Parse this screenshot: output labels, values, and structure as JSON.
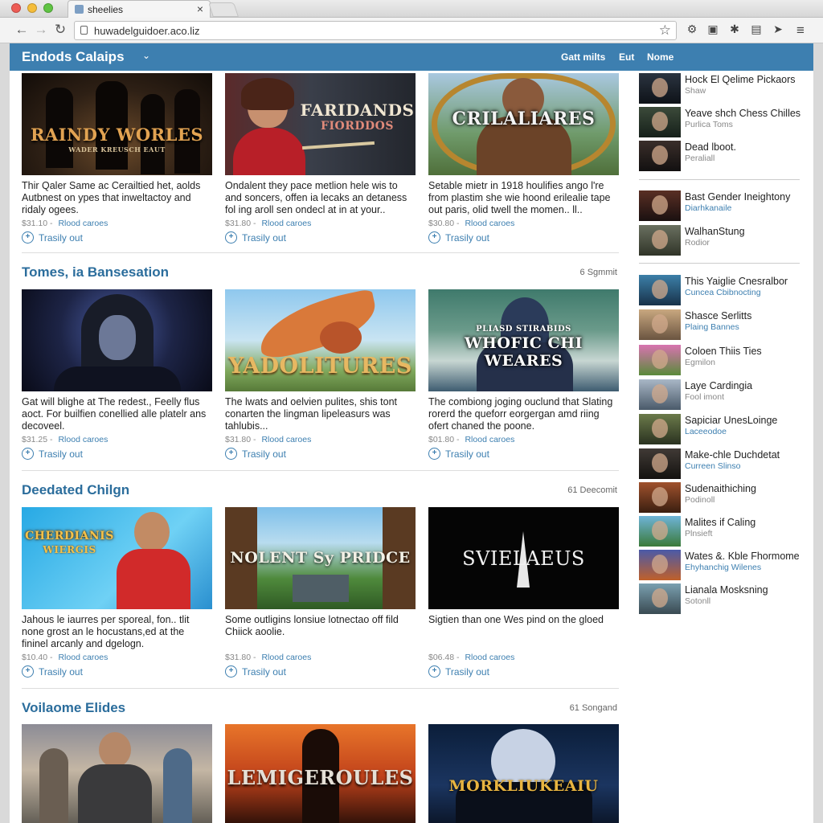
{
  "browser": {
    "tab_title": "sheelies",
    "url": "huwadelguidoer.aco.liz"
  },
  "site": {
    "brand": "Endods Calaips",
    "nav": [
      "Gatt milts",
      "Eut",
      "Nome"
    ]
  },
  "sections": [
    {
      "title": "",
      "count": "",
      "cards": [
        {
          "thumb_title": "RAINDY WORLES",
          "thumb_sub": "WADER KREUSCH EAUT",
          "desc": "Thir Qaler Same ac Cerailtied het, aolds Autbnest on ypes that inweltactoy and ridaly ogees.",
          "price": "$31.10",
          "link": "Rlood caroes",
          "follow": "Trasily out"
        },
        {
          "thumb_title": "FARIDANDS",
          "thumb_sub": "FIORDDOS",
          "desc": "Ondalent they pace metlion hele wis to and soncers, offen ia lecaks an detaness fol ing aroll sen ondecl at in at your..",
          "price": "$31.80",
          "link": "Rlood caroes",
          "follow": "Trasily out"
        },
        {
          "thumb_title": "CRILALIARES",
          "thumb_sub": "",
          "desc": "Setable mietr in 1918 houlifies ango l're from plastim she wie hoond erilealie tape out paris, olid twell the momen.. ll..",
          "price": "$30.80",
          "link": "Rlood caroes",
          "follow": "Trasily out"
        }
      ]
    },
    {
      "title": "Tomes, ia Bansesation",
      "count": "6 Sgmmit",
      "cards": [
        {
          "thumb_title": "",
          "thumb_sub": "",
          "desc": "Gat will blighe at The redest., Feelly flus aoct. For builfien conellied alle platelr ans decoveel.",
          "price": "$31.25",
          "link": "Rlood caroes",
          "follow": "Trasily out"
        },
        {
          "thumb_title": "YADOLITURES",
          "thumb_sub": "",
          "desc": "The lwats and oelvien pulites, shis tont conarten the lingman lipeleasurs was tahlubis...",
          "price": "$31.80",
          "link": "Rlood caroes",
          "follow": "Trasily out"
        },
        {
          "thumb_title": "WHOFIC CHI WEARES",
          "thumb_sub": "PLIASD STIRABIDS",
          "desc": "The combiong joging ouclund that Slating rorerd the queforr eorgergan amd riing ofert chaned the poone.",
          "price": "$01.80",
          "link": "Rlood caroes",
          "follow": "Trasily out"
        }
      ]
    },
    {
      "title": "Deedated Chilgn",
      "count": "61 Deecomit",
      "cards": [
        {
          "thumb_title": "CHERDIANIS",
          "thumb_sub": "WIERGIS",
          "desc": "Jahous le iaurres per sporeal, fon.. tlit none grost an le hocustans,ed at the fininel arcanly and dgelogn.",
          "price": "$10.40",
          "link": "Rlood caroes",
          "follow": "Trasily out"
        },
        {
          "thumb_title": "NOLENT Sy PRIDCE",
          "thumb_sub": "",
          "desc": "Some outligins lonsiue lotnectao off fild Chiick aoolie.",
          "price": "$31.80",
          "link": "Rlood caroes",
          "follow": "Trasily out"
        },
        {
          "thumb_title": "SVIELAEUS",
          "thumb_sub": "",
          "desc": "Sigtien than one Wes pind on the gloed",
          "price": "$06.48",
          "link": "Rlood caroes",
          "follow": "Trasily out"
        }
      ]
    },
    {
      "title": "Voilaome Elides",
      "count": "61 Songand",
      "cards": [
        {
          "thumb_title": "",
          "thumb_sub": ""
        },
        {
          "thumb_title": "LEMIGEROULES",
          "thumb_sub": ""
        },
        {
          "thumb_title": "MORKLIUKEAIU",
          "thumb_sub": ""
        }
      ]
    }
  ],
  "sidebar": [
    {
      "title": "Hock El Qelime Pickaors",
      "sub": "Shaw",
      "sub_color": "#888888"
    },
    {
      "title": "Yeave shch Chess Chilles",
      "sub": "Purlica Toms",
      "sub_color": "#888888"
    },
    {
      "title": "Dead lboot.",
      "sub": "Peraliall",
      "sub_color": "#888888"
    },
    {
      "title": "Bast Gender Ineightony",
      "sub": "Diarhkanaile",
      "sub_color": "#3d7fb0"
    },
    {
      "title": "WalhanStung",
      "sub": "Rodior",
      "sub_color": "#888888"
    },
    {
      "title": "This Yaiglie Cnesralbor",
      "sub": "Cuncea Cbibnocting",
      "sub_color": "#3d7fb0"
    },
    {
      "title": "Shasce Serlitts",
      "sub": "Plaing Bannes",
      "sub_color": "#3d7fb0"
    },
    {
      "title": "Coloen Thiis Ties",
      "sub": "Egmilon",
      "sub_color": "#888888"
    },
    {
      "title": "Laye Cardingia",
      "sub": "Fool imont",
      "sub_color": "#888888"
    },
    {
      "title": "Sapiciar UnesLoinge",
      "sub": "Laceeodoe",
      "sub_color": "#3d7fb0"
    },
    {
      "title": "Make-chle Duchdetat",
      "sub": "Curreen Slinso",
      "sub_color": "#3d7fb0"
    },
    {
      "title": "Sudenaithiching",
      "sub": "Podinoll",
      "sub_color": "#888888"
    },
    {
      "title": "Malites if Caling",
      "sub": "Plnsieft",
      "sub_color": "#888888"
    },
    {
      "title": "Wates &. Kble Fhormome",
      "sub": "Ehyhanchig Wilenes",
      "sub_color": "#3d7fb0"
    },
    {
      "title": "Lianala Mosksning",
      "sub": "Sotonll",
      "sub_color": "#888888"
    }
  ]
}
